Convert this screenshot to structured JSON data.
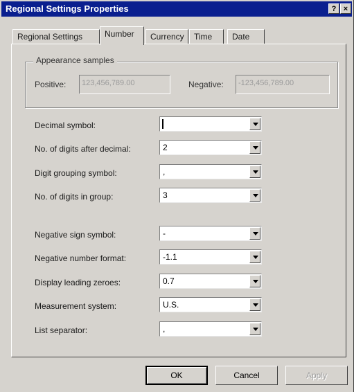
{
  "window": {
    "title": "Regional Settings Properties",
    "help_btn": "?",
    "close_btn": "×"
  },
  "tabs": [
    {
      "label": "Regional Settings",
      "active": false
    },
    {
      "label": "Number",
      "active": true
    },
    {
      "label": "Currency",
      "active": false
    },
    {
      "label": "Time",
      "active": false
    },
    {
      "label": "Date",
      "active": false
    }
  ],
  "samples": {
    "group_label": "Appearance samples",
    "positive_label": "Positive:",
    "positive_value": "123,456,789.00",
    "negative_label": "Negative:",
    "negative_value": "-123,456,789.00"
  },
  "settings": [
    {
      "label": "Decimal symbol:",
      "value": ""
    },
    {
      "label": "No. of digits after decimal:",
      "value": "2"
    },
    {
      "label": "Digit grouping symbol:",
      "value": ","
    },
    {
      "label": "No. of digits in group:",
      "value": "3"
    },
    {
      "label": "Negative sign symbol:",
      "value": "-"
    },
    {
      "label": "Negative number format:",
      "value": "-1.1"
    },
    {
      "label": "Display leading zeroes:",
      "value": "0.7"
    },
    {
      "label": "Measurement system:",
      "value": "U.S."
    },
    {
      "label": "List separator:",
      "value": ","
    }
  ],
  "buttons": {
    "ok": "OK",
    "cancel": "Cancel",
    "apply": "Apply"
  }
}
